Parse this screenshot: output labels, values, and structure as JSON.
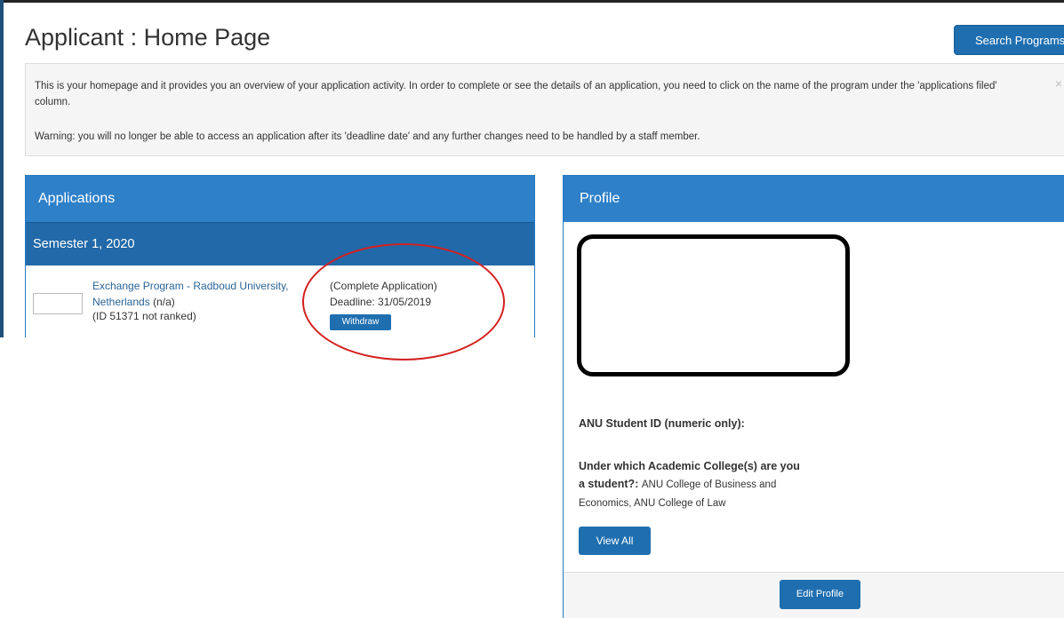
{
  "header": {
    "title": "Applicant : Home Page",
    "search_button": "Search Programs"
  },
  "info": {
    "text1": "This is your homepage and it provides you an overview of your application activity. In order to complete or see the details of an application, you need to click on the name of the program under the 'applications filed' column.",
    "text2": "Warning: you will no longer be able to access an application after its 'deadline date' and any further changes need to be handled by a staff member.",
    "close": "×"
  },
  "applications": {
    "title": "Applications",
    "semester": "Semester 1, 2020",
    "items": [
      {
        "program": "Exchange Program - Radboud University, Netherlands",
        "suffix": "(n/a)",
        "id_text": "(ID 51371 not ranked)",
        "status": "(Complete Application)",
        "deadline": "Deadline: 31/05/2019",
        "action": "Withdraw"
      }
    ]
  },
  "profile": {
    "title": "Profile",
    "student_id_label": "ANU Student ID (numeric only):",
    "college_label": "Under which Academic College(s) are you a student?:",
    "college_value": "ANU College of Business and Economics, ANU College of Law",
    "view_all": "View All",
    "edit_profile": "Edit Profile"
  },
  "colors": {
    "primary_button": "#1f6fb0",
    "panel_header": "#2e80c8",
    "semester_header": "#2169a8",
    "link": "#2a6496",
    "annotation_circle": "#d42020"
  }
}
